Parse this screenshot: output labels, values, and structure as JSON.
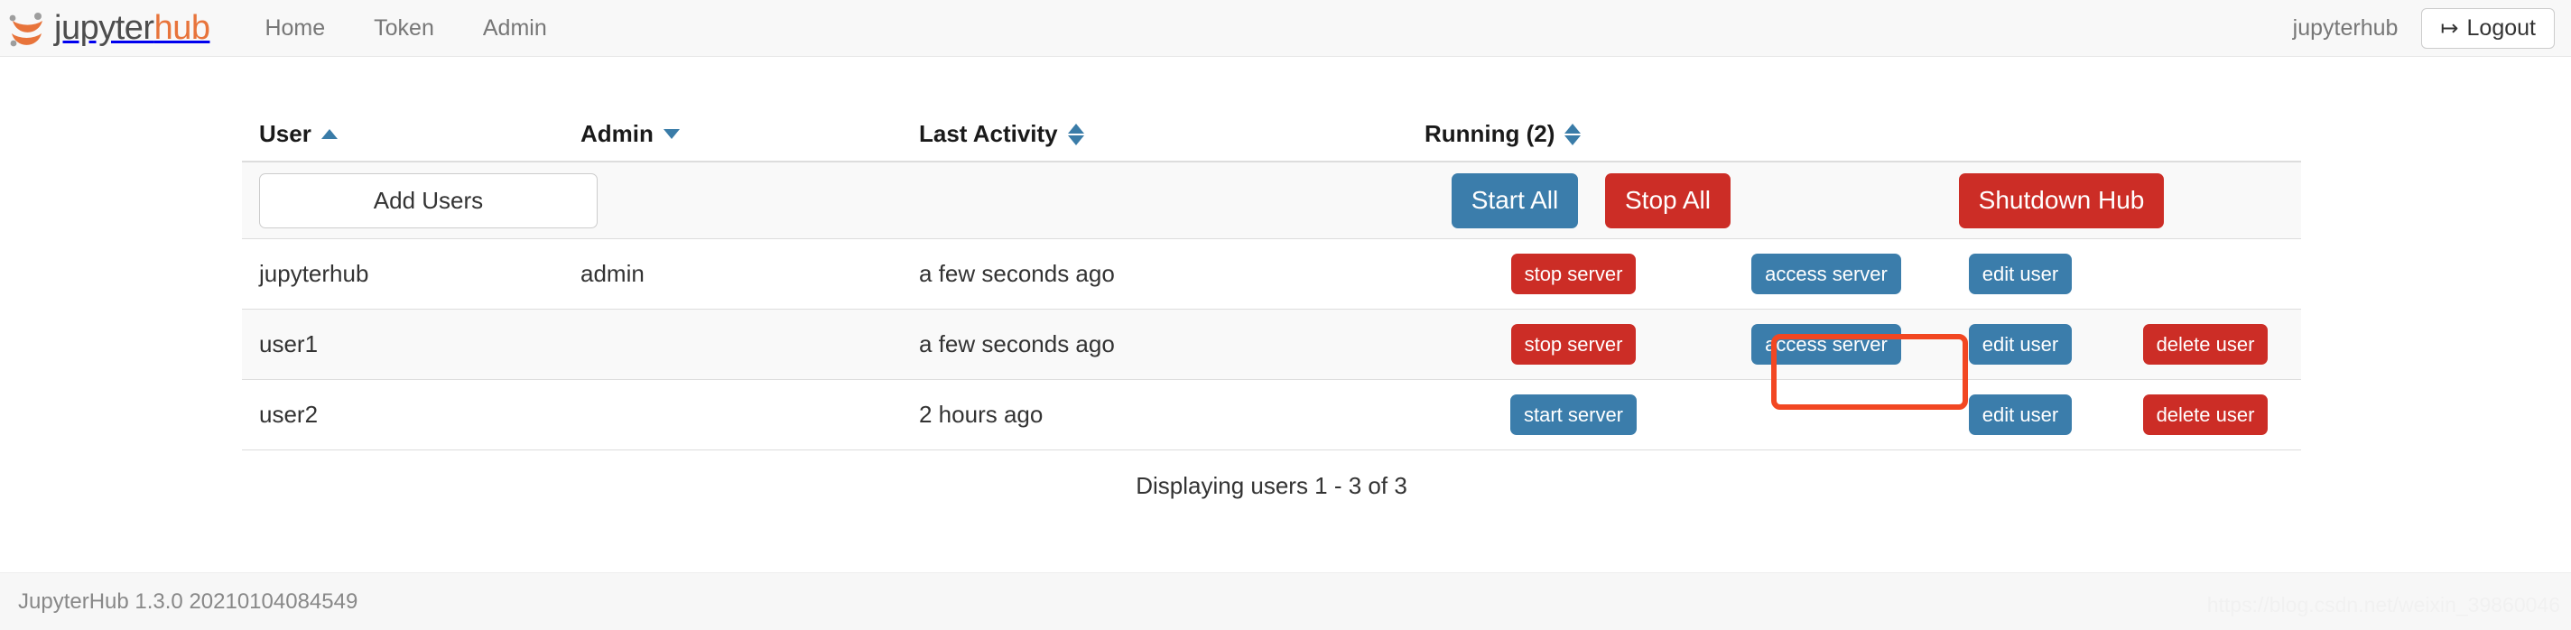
{
  "navbar": {
    "brand_first": "jupyter",
    "brand_second": "hub",
    "logo_icon": "jupyter-logo-icon",
    "links": [
      {
        "label": "Home"
      },
      {
        "label": "Token"
      },
      {
        "label": "Admin"
      }
    ],
    "user": "jupyterhub",
    "logout_label": "Logout",
    "logout_icon": "sign-out-icon"
  },
  "table": {
    "headers": [
      {
        "label": "User",
        "sort": "asc"
      },
      {
        "label": "Admin",
        "sort": "desc"
      },
      {
        "label": "Last Activity",
        "sort": "none"
      },
      {
        "label": "Running (2)",
        "sort": "none"
      }
    ],
    "toolbar": {
      "add_users_label": "Add Users",
      "start_all_label": "Start All",
      "stop_all_label": "Stop All",
      "shutdown_hub_label": "Shutdown Hub"
    },
    "rows": [
      {
        "user": "jupyterhub",
        "admin": "admin",
        "last_activity": "a few seconds ago",
        "server_label": "stop server",
        "server_state": "running",
        "access_label": "access server",
        "edit_label": "edit user",
        "delete_label": ""
      },
      {
        "user": "user1",
        "admin": "",
        "last_activity": "a few seconds ago",
        "server_label": "stop server",
        "server_state": "running",
        "access_label": "access server",
        "edit_label": "edit user",
        "delete_label": "delete user"
      },
      {
        "user": "user2",
        "admin": "",
        "last_activity": "2 hours ago",
        "server_label": "start server",
        "server_state": "stopped",
        "access_label": "",
        "edit_label": "edit user",
        "delete_label": "delete user"
      }
    ],
    "displaying": "Displaying users 1 - 3 of 3"
  },
  "footer": {
    "version": "JupyterHub 1.3.0 20210104084549",
    "watermark": "https://blog.csdn.net/weixin_39860046"
  },
  "colors": {
    "brand_orange": "#e8743b",
    "primary_blue": "#3b7dab",
    "danger_red": "#cc2d26",
    "highlight": "#f24722"
  }
}
